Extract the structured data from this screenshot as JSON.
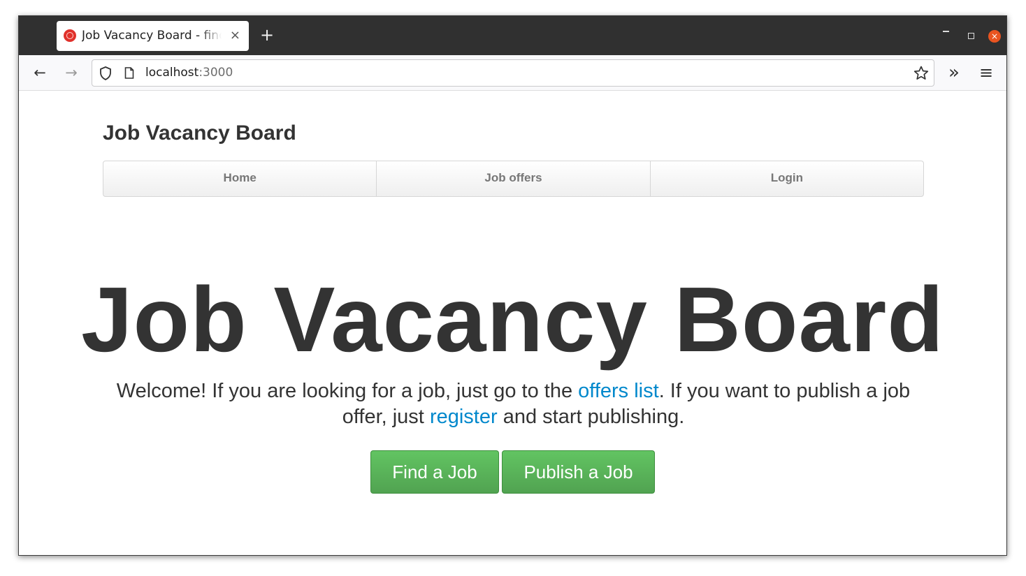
{
  "browser": {
    "tab_title": "Job Vacancy Board - find a job",
    "tab_close": "×",
    "new_tab": "+",
    "window_close": "×",
    "url_host": "localhost",
    "url_port": ":3000",
    "back_arrow": "←",
    "forward_arrow": "→",
    "overflow": "»",
    "menu": "≡"
  },
  "site": {
    "brand": "Job Vacancy Board",
    "menu": [
      {
        "label": "Home"
      },
      {
        "label": "Job offers"
      },
      {
        "label": "Login"
      }
    ]
  },
  "hero": {
    "title": "Job Vacancy Board",
    "lead_part1": "Welcome! If you are looking for a job, just go to the ",
    "offers_link": "offers list",
    "lead_part2": ". If you want to publish a job offer, just ",
    "register_link": "register",
    "lead_part3": " and start publishing.",
    "find_button": "Find a Job",
    "publish_button": "Publish a Job"
  },
  "colors": {
    "link": "#0088cc",
    "button_green": "#5bb75b",
    "titlebar": "#303030"
  }
}
